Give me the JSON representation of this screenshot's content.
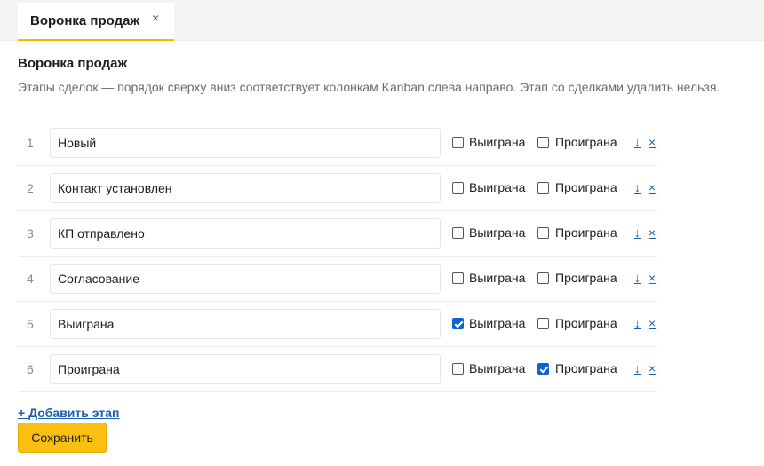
{
  "tab": {
    "label": "Воронка продаж",
    "close": "×"
  },
  "page": {
    "title": "Воронка продаж",
    "description": "Этапы сделок — порядок сверху вниз соответствует колонкам Kanban слева направо. Этап со сделками удалить нельзя."
  },
  "labels": {
    "won": "Выиграна",
    "lost": "Проиграна",
    "move_down": "↓",
    "delete": "×"
  },
  "stages": [
    {
      "num": "1",
      "name": "Новый",
      "won": false,
      "lost": false
    },
    {
      "num": "2",
      "name": "Контакт установлен",
      "won": false,
      "lost": false
    },
    {
      "num": "3",
      "name": "КП отправлено",
      "won": false,
      "lost": false
    },
    {
      "num": "4",
      "name": "Согласование",
      "won": false,
      "lost": false
    },
    {
      "num": "5",
      "name": "Выиграна",
      "won": true,
      "lost": false
    },
    {
      "num": "6",
      "name": "Проиграна",
      "won": false,
      "lost": true
    }
  ],
  "actions": {
    "add_stage": "+ Добавить этап",
    "save": "Сохранить"
  },
  "colors": {
    "accent": "#fbbf10",
    "link": "#1a5fb4",
    "checkbox": "#0b63d4"
  }
}
